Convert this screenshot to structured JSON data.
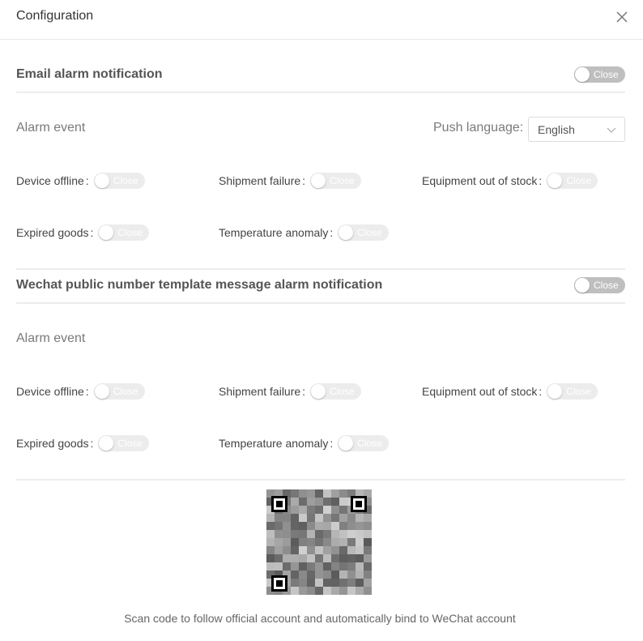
{
  "header": {
    "title": "Configuration",
    "close_icon": "close-icon"
  },
  "email_section": {
    "title": "Email alarm notification",
    "toggle_label": "Close",
    "alarm_event_label": "Alarm event",
    "push_language": {
      "label": "Push language:",
      "selected": "English"
    },
    "events": [
      {
        "label": "Device offline",
        "state": "Close"
      },
      {
        "label": "Shipment failure",
        "state": "Close"
      },
      {
        "label": "Equipment out of stock",
        "state": "Close"
      },
      {
        "label": "Expired goods",
        "state": "Close"
      },
      {
        "label": "Temperature anomaly",
        "state": "Close"
      }
    ]
  },
  "wechat_section": {
    "title": "Wechat public number template message alarm notification",
    "toggle_label": "Close",
    "alarm_event_label": "Alarm event",
    "events": [
      {
        "label": "Device offline",
        "state": "Close"
      },
      {
        "label": "Shipment failure",
        "state": "Close"
      },
      {
        "label": "Equipment out of stock",
        "state": "Close"
      },
      {
        "label": "Expired goods",
        "state": "Close"
      },
      {
        "label": "Temperature anomaly",
        "state": "Close"
      }
    ]
  },
  "qr": {
    "caption": "Scan code to follow official account and automatically bind to WeChat account"
  },
  "colors": {
    "switch_off": "#bfbfbf",
    "switch_disabled": "#ececec",
    "divider": "#ececec"
  }
}
